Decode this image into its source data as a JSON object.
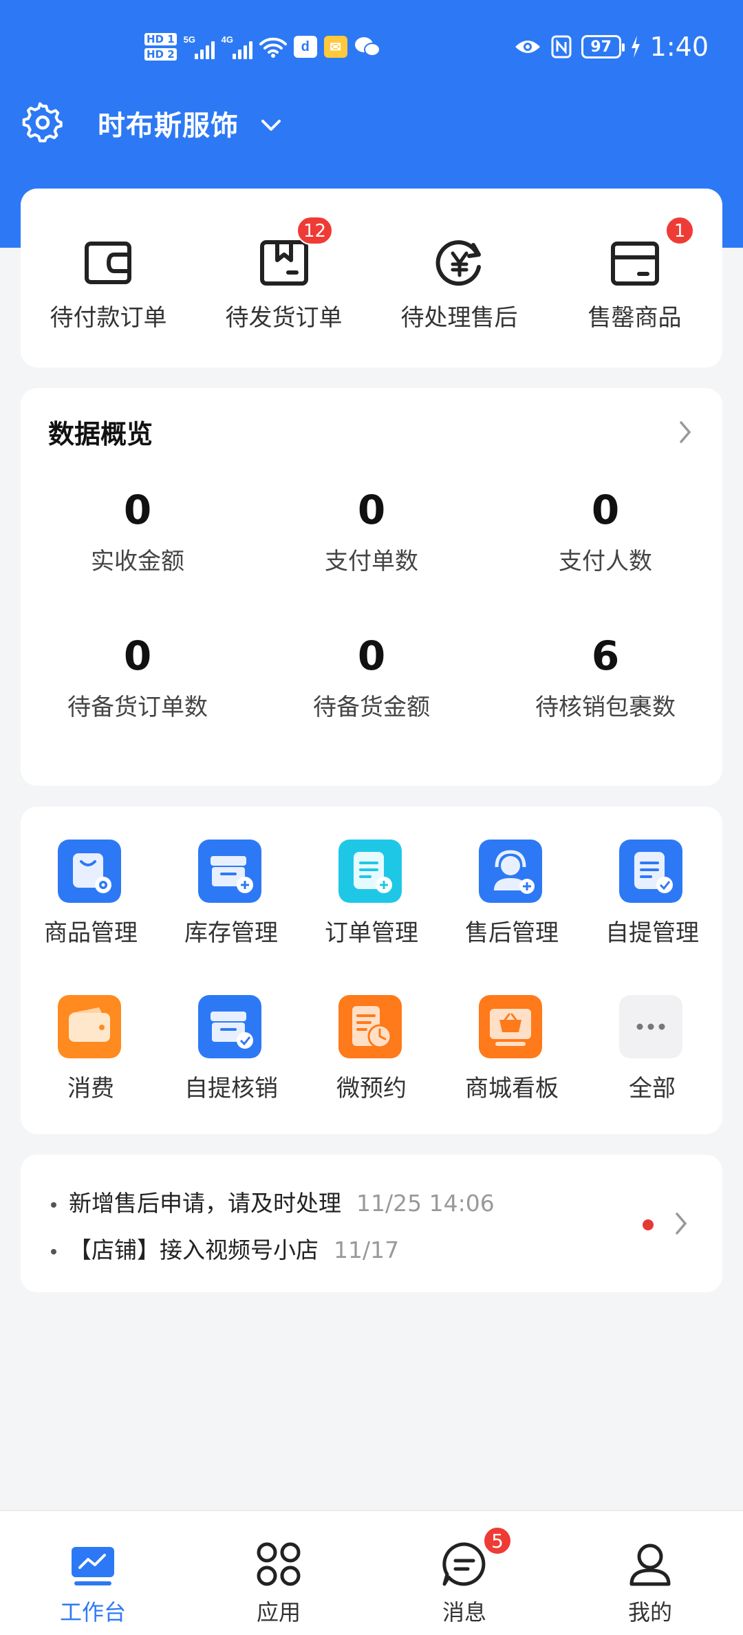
{
  "status_bar": {
    "sim_labels": [
      "HD 1",
      "HD 2"
    ],
    "network_labels": [
      "5G",
      "4G"
    ],
    "battery": "97",
    "time": "1:40"
  },
  "header": {
    "store_name": "时布斯服饰"
  },
  "quick_entries": [
    {
      "label": "待付款订单",
      "icon": "wallet-icon",
      "badge": ""
    },
    {
      "label": "待发货订单",
      "icon": "package-bookmark-icon",
      "badge": "12"
    },
    {
      "label": "待处理售后",
      "icon": "yen-refresh-icon",
      "badge": ""
    },
    {
      "label": "售罄商品",
      "icon": "box-icon",
      "badge": "1"
    }
  ],
  "overview": {
    "title": "数据概览",
    "stats": [
      {
        "value": "0",
        "label": "实收金额"
      },
      {
        "value": "0",
        "label": "支付单数"
      },
      {
        "value": "0",
        "label": "支付人数"
      },
      {
        "value": "0",
        "label": "待备货订单数"
      },
      {
        "value": "0",
        "label": "待备货金额"
      },
      {
        "value": "6",
        "label": "待核销包裹数"
      }
    ]
  },
  "apps": [
    {
      "label": "商品管理",
      "icon": "product-bag-icon",
      "color": "#2d79f5"
    },
    {
      "label": "库存管理",
      "icon": "inventory-icon",
      "color": "#2d79f5"
    },
    {
      "label": "订单管理",
      "icon": "order-clipboard-icon",
      "color": "#1fc7e6"
    },
    {
      "label": "售后管理",
      "icon": "headset-icon",
      "color": "#2d79f5"
    },
    {
      "label": "自提管理",
      "icon": "pickup-clipboard-icon",
      "color": "#2d79f5"
    },
    {
      "label": "消费",
      "icon": "wallet-card-icon",
      "color": "#ff8a1f"
    },
    {
      "label": "自提核销",
      "icon": "pickup-verify-icon",
      "color": "#2d79f5"
    },
    {
      "label": "微预约",
      "icon": "appointment-icon",
      "color": "#ff7a1a"
    },
    {
      "label": "商城看板",
      "icon": "shop-basket-icon",
      "color": "#ff7a1a"
    },
    {
      "label": "全部",
      "icon": "more-dots-icon",
      "color": "#f1f1f3"
    }
  ],
  "notices": [
    {
      "text": "新增售后申请，请及时处理",
      "time": "11/25 14:06"
    },
    {
      "text": "【店铺】接入视频号小店",
      "time": "11/17"
    }
  ],
  "tabbar": [
    {
      "label": "工作台",
      "icon": "dashboard-icon",
      "badge": ""
    },
    {
      "label": "应用",
      "icon": "apps-grid-icon",
      "badge": ""
    },
    {
      "label": "消息",
      "icon": "message-icon",
      "badge": "5"
    },
    {
      "label": "我的",
      "icon": "profile-icon",
      "badge": ""
    }
  ],
  "colors": {
    "accent": "#2d79f5",
    "badge": "#ef3b35"
  }
}
